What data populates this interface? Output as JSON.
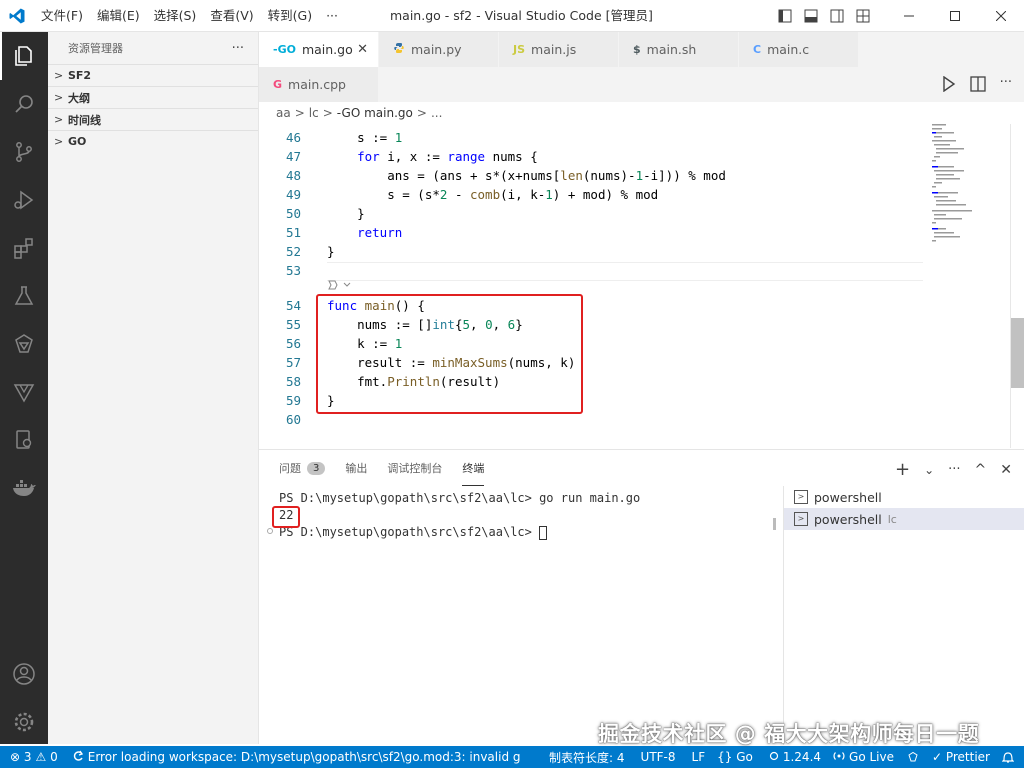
{
  "window": {
    "title": "main.go - sf2 - Visual Studio Code [管理员]",
    "menu": [
      "文件(F)",
      "编辑(E)",
      "选择(S)",
      "查看(V)",
      "转到(G)",
      "···"
    ]
  },
  "activity_bar": {
    "items": [
      "explorer-icon",
      "search-icon",
      "source-control-icon",
      "run-debug-icon",
      "extensions-icon",
      "testing-icon",
      "goland-icon",
      "vue-icon",
      "remote-icon",
      "docker-icon"
    ],
    "bottom": [
      "account-icon",
      "settings-icon"
    ]
  },
  "sidebar": {
    "title": "资源管理器",
    "more": "···",
    "sections": [
      "SF2",
      "大纲",
      "时间线",
      "GO"
    ]
  },
  "tabs": [
    {
      "label": "main.go",
      "icon": "-GO",
      "icon_color": "#00add8",
      "active": true,
      "close": "✕"
    },
    {
      "label": "main.py",
      "icon": "py",
      "icon_color": "#3572a5",
      "active": false
    },
    {
      "label": "main.js",
      "icon": "JS",
      "icon_color": "#cbcb41",
      "active": false
    },
    {
      "label": "main.sh",
      "icon": "$",
      "icon_color": "#4d5a5e",
      "active": false
    },
    {
      "label": "main.c",
      "icon": "C",
      "icon_color": "#599eff",
      "active": false
    },
    {
      "label": "main.cpp",
      "icon": "G",
      "icon_color": "#f34b7d",
      "active": false
    }
  ],
  "breadcrumb": [
    "aa",
    ">",
    "lc",
    ">",
    "-GO main.go",
    ">",
    "..."
  ],
  "code": {
    "lines": [
      {
        "n": "46",
        "text": "    s := 1"
      },
      {
        "n": "47",
        "text": "    for i, x := range nums {"
      },
      {
        "n": "48",
        "text": "        ans = (ans + s*(x+nums[len(nums)-1-i])) % mod"
      },
      {
        "n": "49",
        "text": "        s = (s*2 - comb(i, k-1) + mod) % mod"
      },
      {
        "n": "50",
        "text": "    }"
      },
      {
        "n": "51",
        "text": "    return"
      },
      {
        "n": "52",
        "text": "}"
      },
      {
        "n": "53",
        "text": ""
      },
      {
        "n": "54",
        "text": "func main() {"
      },
      {
        "n": "55",
        "text": "    nums := []int{5, 0, 6}"
      },
      {
        "n": "56",
        "text": "    k := 1"
      },
      {
        "n": "57",
        "text": "    result := minMaxSums(nums, k)"
      },
      {
        "n": "58",
        "text": "    fmt.Println(result)"
      },
      {
        "n": "59",
        "text": "}"
      },
      {
        "n": "60",
        "text": ""
      }
    ]
  },
  "panel": {
    "tabs": [
      {
        "label": "问题",
        "badge": "3"
      },
      {
        "label": "输出"
      },
      {
        "label": "调试控制台"
      },
      {
        "label": "终端",
        "active": true
      }
    ],
    "actions": [
      "+",
      "⌄",
      "···",
      "^",
      "✕"
    ],
    "terminal": {
      "lines": [
        "PS D:\\mysetup\\gopath\\src\\sf2\\aa\\lc> go run main.go",
        "22",
        "PS D:\\mysetup\\gopath\\src\\sf2\\aa\\lc> "
      ]
    },
    "terminals": [
      {
        "label": "powershell",
        "sub": ""
      },
      {
        "label": "powershell",
        "sub": "lc"
      }
    ]
  },
  "statusbar": {
    "errors": "⊗ 3",
    "warnings": "⚠ 0",
    "message": "Error loading workspace: D:\\mysetup\\gopath\\src\\sf2\\go.mod:3: invalid g",
    "tab_size": "制表符长度: 4",
    "encoding": "UTF-8",
    "eol": "LF",
    "language": "{} Go",
    "go_version": "1.24.4",
    "go_live": "Go Live",
    "prettier": "✓ Prettier"
  },
  "watermark": "掘金技术社区 @ 福大大架构师每日一题",
  "colors": {
    "accent": "#007acc",
    "highlight_box": "#e02020",
    "activity_bg": "#2c2c2c"
  }
}
